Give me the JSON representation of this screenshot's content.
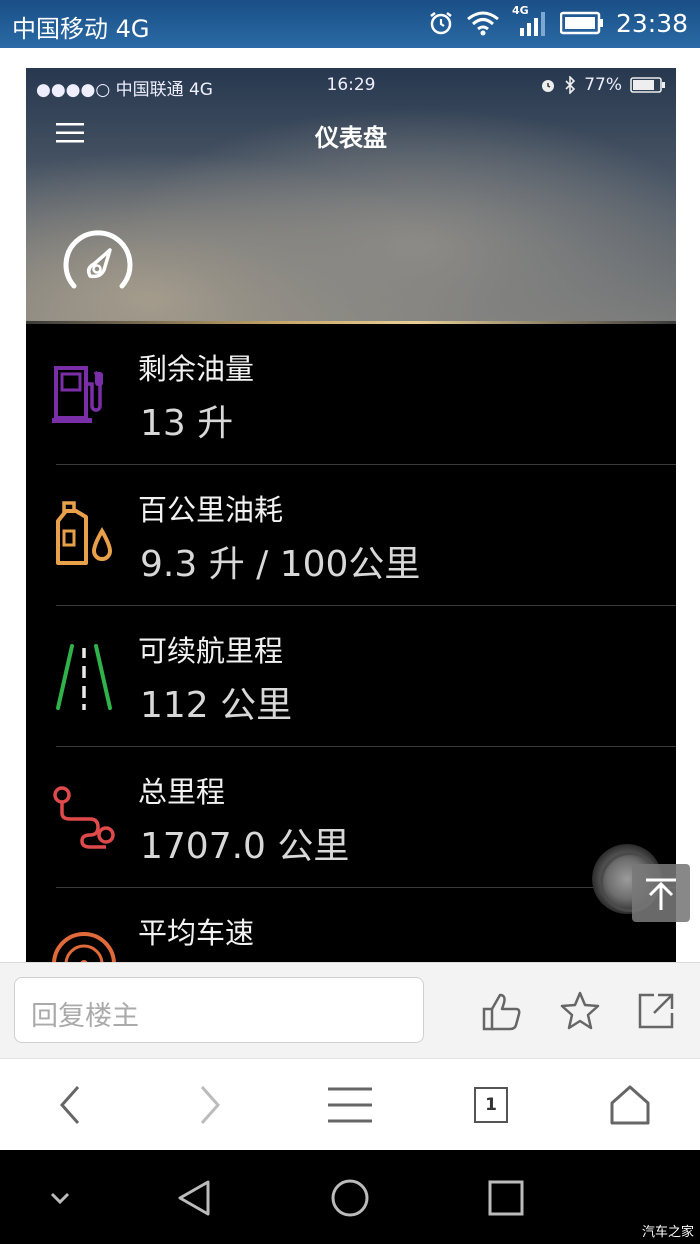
{
  "outer_status": {
    "carrier": "中国移动 4G",
    "network_badge": "4G",
    "time": "23:38",
    "icons": [
      "alarm-icon",
      "wifi-icon",
      "signal-icon",
      "battery-icon"
    ]
  },
  "inner_status": {
    "carrier": "●●●●○ 中国联通   4G",
    "time": "16:29",
    "battery": "77%",
    "icons": [
      "alarm-icon",
      "bluetooth-icon",
      "battery-icon"
    ]
  },
  "app": {
    "title": "仪表盘",
    "icons": [
      "menu-icon",
      "gauge-icon"
    ]
  },
  "rows": [
    {
      "label": "剩余油量",
      "value": "13 升",
      "icon": "fuel-pump-icon",
      "color": "#7a2fa8"
    },
    {
      "label": "百公里油耗",
      "value": "9.3 升 / 100公里",
      "icon": "oil-bottle-icon",
      "color": "#e8a04a"
    },
    {
      "label": "可续航里程",
      "value": "112 公里",
      "icon": "road-icon",
      "color": "#2fb24a"
    },
    {
      "label": "总里程",
      "value": "1707.0 公里",
      "icon": "route-icon",
      "color": "#e04a4a"
    },
    {
      "label": "平均车速",
      "value": "",
      "icon": "speed-wheel-icon",
      "color": "#e06a3a"
    }
  ],
  "reply_bar": {
    "placeholder": "回复楼主",
    "icons": [
      "like-icon",
      "favorite-star-icon",
      "share-icon"
    ]
  },
  "browser_nav": {
    "tab_count": "1",
    "icons": [
      "back-icon",
      "forward-icon",
      "menu-lines-icon",
      "tabs-icon",
      "home-icon"
    ]
  },
  "system_nav": {
    "icons": [
      "chevron-down-icon",
      "back-triangle-icon",
      "home-circle-icon",
      "recents-square-icon"
    ]
  },
  "watermark": "汽车之家",
  "colors": {
    "outer_status_bg": "#2a6aa6",
    "list_bg": "#000000",
    "gold_accent": "#c8a86a"
  }
}
